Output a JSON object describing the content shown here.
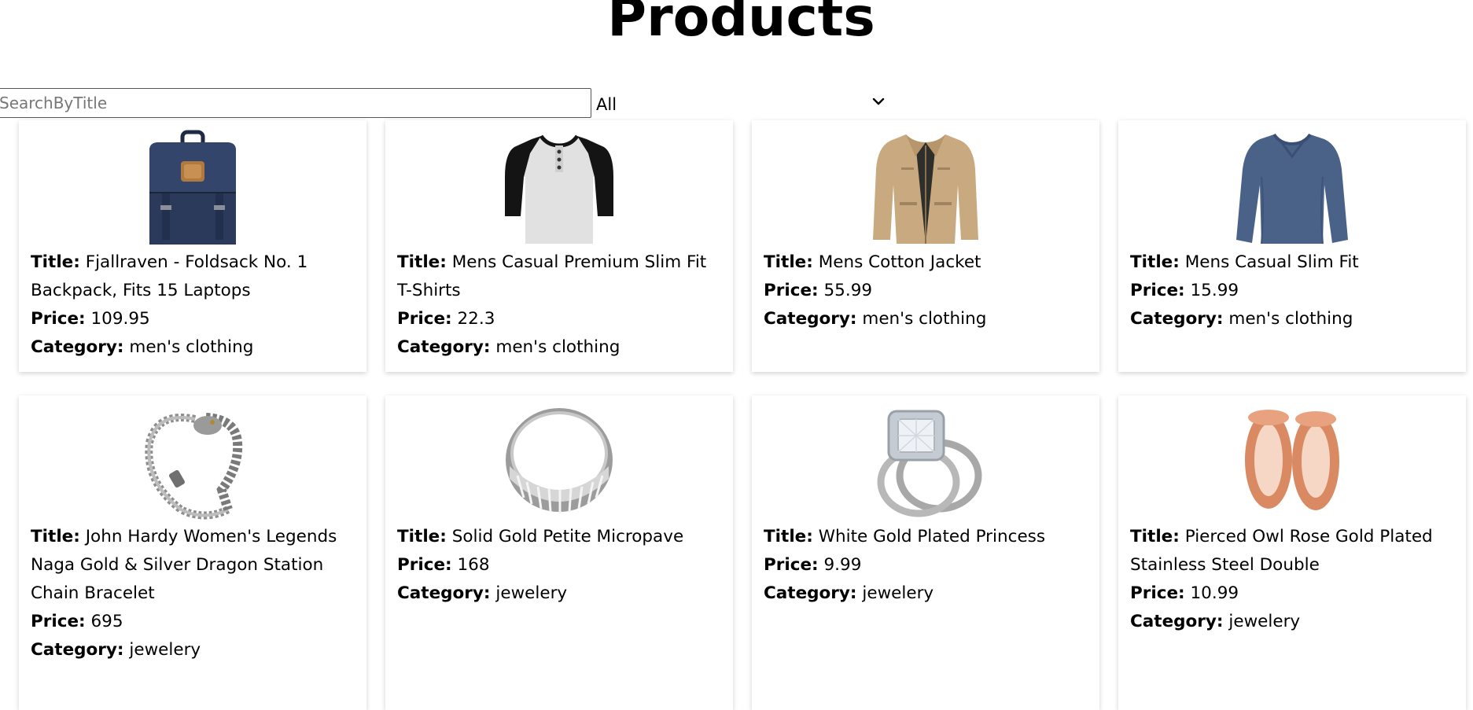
{
  "page": {
    "title": "Products"
  },
  "filters": {
    "search_placeholder": "SearchByTitle",
    "search_value": "",
    "category_selected": "All"
  },
  "labels": {
    "title": "Title:",
    "price": "Price:",
    "category": "Category:"
  },
  "products": [
    {
      "title": "Fjallraven - Foldsack No. 1 Backpack, Fits 15 Laptops",
      "price": "109.95",
      "category": "men's clothing",
      "image": "backpack-image"
    },
    {
      "title": "Mens Casual Premium Slim Fit T-Shirts",
      "price": "22.3",
      "category": "men's clothing",
      "image": "raglan-shirt-image"
    },
    {
      "title": "Mens Cotton Jacket",
      "price": "55.99",
      "category": "men's clothing",
      "image": "jacket-image"
    },
    {
      "title": "Mens Casual Slim Fit",
      "price": "15.99",
      "category": "men's clothing",
      "image": "long-sleeve-shirt-image"
    },
    {
      "title": "John Hardy Women's Legends Naga Gold & Silver Dragon Station Chain Bracelet",
      "price": "695",
      "category": "jewelery",
      "image": "dragon-bracelet-image"
    },
    {
      "title": "Solid Gold Petite Micropave",
      "price": "168",
      "category": "jewelery",
      "image": "silver-ring-image"
    },
    {
      "title": "White Gold Plated Princess",
      "price": "9.99",
      "category": "jewelery",
      "image": "diamond-ring-image"
    },
    {
      "title": "Pierced Owl Rose Gold Plated Stainless Steel Double",
      "price": "10.99",
      "category": "jewelery",
      "image": "rose-gold-plugs-image"
    }
  ],
  "colors": {
    "navy": "#2b3a5a",
    "black": "#111111",
    "light_gray": "#d9d9d9",
    "khaki": "#c9a97f",
    "slate_blue": "#4a6188",
    "silver": "#a8a8a8",
    "rose_gold": "#d98a62"
  }
}
